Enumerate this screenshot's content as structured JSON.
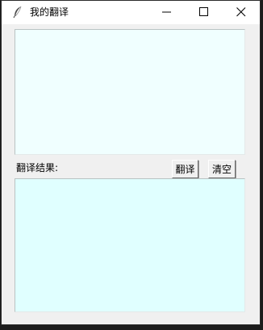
{
  "window": {
    "title": "我的翻译",
    "icon": "feather-icon",
    "controls": {
      "minimize": "minimize-icon",
      "maximize": "maximize-icon",
      "close": "close-icon"
    }
  },
  "input": {
    "value": ""
  },
  "toolbar": {
    "result_label": "翻译结果:",
    "translate_label": "翻译",
    "clear_label": "清空"
  },
  "output": {
    "value": ""
  },
  "colors": {
    "input_bg": "#f0ffff",
    "output_bg": "#e0ffff",
    "window_bg": "#f0f0f0"
  }
}
